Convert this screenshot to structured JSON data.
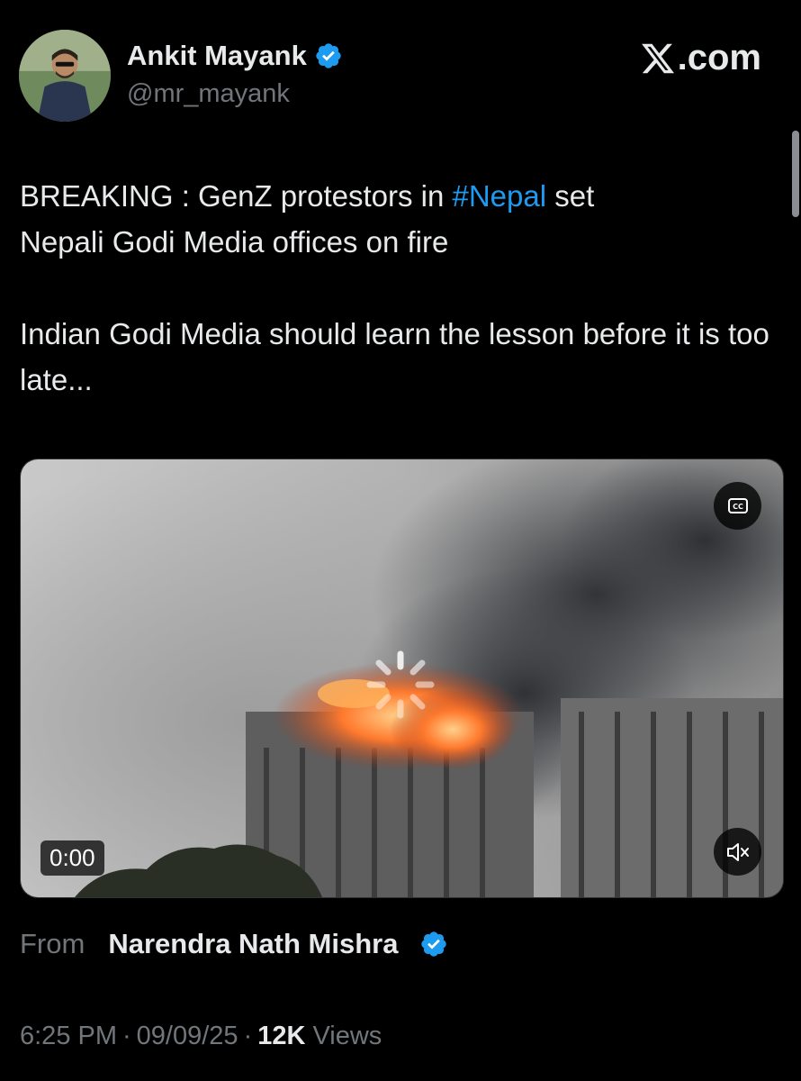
{
  "author": {
    "display_name": "Ankit Mayank",
    "handle": "@mr_mayank",
    "verified": true
  },
  "brand": {
    "label": ".com",
    "icon": "x-logo-icon"
  },
  "tweet": {
    "segments": [
      "BREAKING : GenZ protestors in ",
      "#Nepal",
      " set\nNepali Godi Media offices on fire\n\nIndian Godi Media should learn the lesson before it is too late..."
    ]
  },
  "media": {
    "type": "video",
    "time": "0:00",
    "captions_icon": "closed-captions-icon",
    "mute_icon": "speaker-muted-icon",
    "loading_icon": "loading-spinner-icon"
  },
  "source": {
    "from_label": "From",
    "name": "Narendra Nath Mishra",
    "verified": true
  },
  "meta": {
    "time": "6:25 PM",
    "separator": "·",
    "date": "09/09/25",
    "views_count": "12K",
    "views_label": "Views"
  },
  "colors": {
    "background": "#000000",
    "text": "#e7e9ea",
    "secondary": "#71767b",
    "accent": "#1d9bf0"
  }
}
